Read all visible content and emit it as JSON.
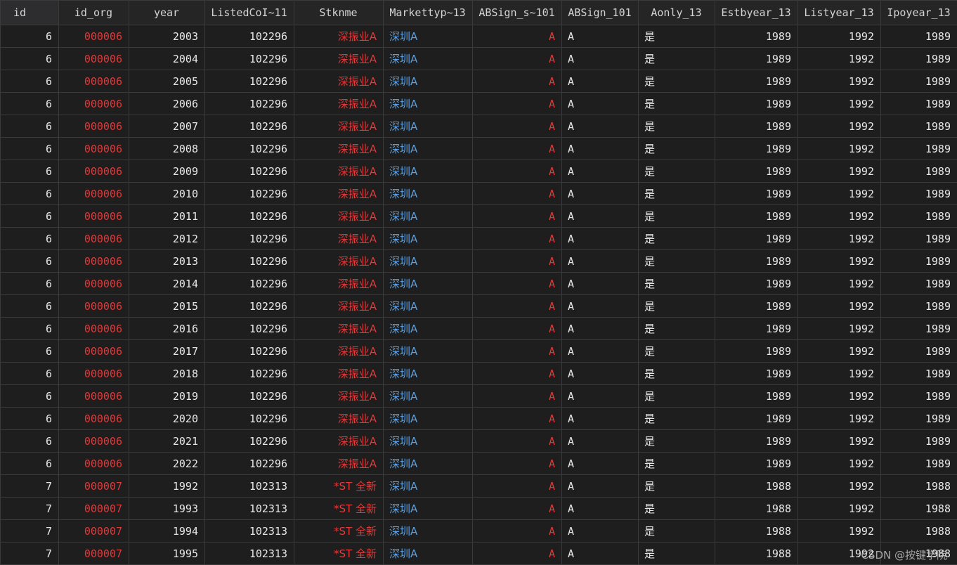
{
  "columns": [
    "id",
    "id_org",
    "year",
    "ListedCoI~11",
    "Stknme",
    "Markettyp~13",
    "ABSign_s~101",
    "ABSign_101",
    "Aonly_13",
    "Estbyear_13",
    "Listyear_13",
    "Ipoyear_13"
  ],
  "rows": [
    [
      "6",
      "000006",
      "2003",
      "102296",
      "深振业A",
      "深圳A",
      "A",
      "A",
      "是",
      "1989",
      "1992",
      "1989"
    ],
    [
      "6",
      "000006",
      "2004",
      "102296",
      "深振业A",
      "深圳A",
      "A",
      "A",
      "是",
      "1989",
      "1992",
      "1989"
    ],
    [
      "6",
      "000006",
      "2005",
      "102296",
      "深振业A",
      "深圳A",
      "A",
      "A",
      "是",
      "1989",
      "1992",
      "1989"
    ],
    [
      "6",
      "000006",
      "2006",
      "102296",
      "深振业A",
      "深圳A",
      "A",
      "A",
      "是",
      "1989",
      "1992",
      "1989"
    ],
    [
      "6",
      "000006",
      "2007",
      "102296",
      "深振业A",
      "深圳A",
      "A",
      "A",
      "是",
      "1989",
      "1992",
      "1989"
    ],
    [
      "6",
      "000006",
      "2008",
      "102296",
      "深振业A",
      "深圳A",
      "A",
      "A",
      "是",
      "1989",
      "1992",
      "1989"
    ],
    [
      "6",
      "000006",
      "2009",
      "102296",
      "深振业A",
      "深圳A",
      "A",
      "A",
      "是",
      "1989",
      "1992",
      "1989"
    ],
    [
      "6",
      "000006",
      "2010",
      "102296",
      "深振业A",
      "深圳A",
      "A",
      "A",
      "是",
      "1989",
      "1992",
      "1989"
    ],
    [
      "6",
      "000006",
      "2011",
      "102296",
      "深振业A",
      "深圳A",
      "A",
      "A",
      "是",
      "1989",
      "1992",
      "1989"
    ],
    [
      "6",
      "000006",
      "2012",
      "102296",
      "深振业A",
      "深圳A",
      "A",
      "A",
      "是",
      "1989",
      "1992",
      "1989"
    ],
    [
      "6",
      "000006",
      "2013",
      "102296",
      "深振业A",
      "深圳A",
      "A",
      "A",
      "是",
      "1989",
      "1992",
      "1989"
    ],
    [
      "6",
      "000006",
      "2014",
      "102296",
      "深振业A",
      "深圳A",
      "A",
      "A",
      "是",
      "1989",
      "1992",
      "1989"
    ],
    [
      "6",
      "000006",
      "2015",
      "102296",
      "深振业A",
      "深圳A",
      "A",
      "A",
      "是",
      "1989",
      "1992",
      "1989"
    ],
    [
      "6",
      "000006",
      "2016",
      "102296",
      "深振业A",
      "深圳A",
      "A",
      "A",
      "是",
      "1989",
      "1992",
      "1989"
    ],
    [
      "6",
      "000006",
      "2017",
      "102296",
      "深振业A",
      "深圳A",
      "A",
      "A",
      "是",
      "1989",
      "1992",
      "1989"
    ],
    [
      "6",
      "000006",
      "2018",
      "102296",
      "深振业A",
      "深圳A",
      "A",
      "A",
      "是",
      "1989",
      "1992",
      "1989"
    ],
    [
      "6",
      "000006",
      "2019",
      "102296",
      "深振业A",
      "深圳A",
      "A",
      "A",
      "是",
      "1989",
      "1992",
      "1989"
    ],
    [
      "6",
      "000006",
      "2020",
      "102296",
      "深振业A",
      "深圳A",
      "A",
      "A",
      "是",
      "1989",
      "1992",
      "1989"
    ],
    [
      "6",
      "000006",
      "2021",
      "102296",
      "深振业A",
      "深圳A",
      "A",
      "A",
      "是",
      "1989",
      "1992",
      "1989"
    ],
    [
      "6",
      "000006",
      "2022",
      "102296",
      "深振业A",
      "深圳A",
      "A",
      "A",
      "是",
      "1989",
      "1992",
      "1989"
    ],
    [
      "7",
      "000007",
      "1992",
      "102313",
      "*ST 全新",
      "深圳A",
      "A",
      "A",
      "是",
      "1988",
      "1992",
      "1988"
    ],
    [
      "7",
      "000007",
      "1993",
      "102313",
      "*ST 全新",
      "深圳A",
      "A",
      "A",
      "是",
      "1988",
      "1992",
      "1988"
    ],
    [
      "7",
      "000007",
      "1994",
      "102313",
      "*ST 全新",
      "深圳A",
      "A",
      "A",
      "是",
      "1988",
      "1992",
      "1988"
    ],
    [
      "7",
      "000007",
      "1995",
      "102313",
      "*ST 全新",
      "深圳A",
      "A",
      "A",
      "是",
      "1988",
      "1992",
      "1988"
    ]
  ],
  "watermark": "CSDN @按键学院",
  "colors": {
    "background": "#1e1e1e",
    "string_red": "#e03a3a",
    "label_blue": "#5b9fe0"
  }
}
